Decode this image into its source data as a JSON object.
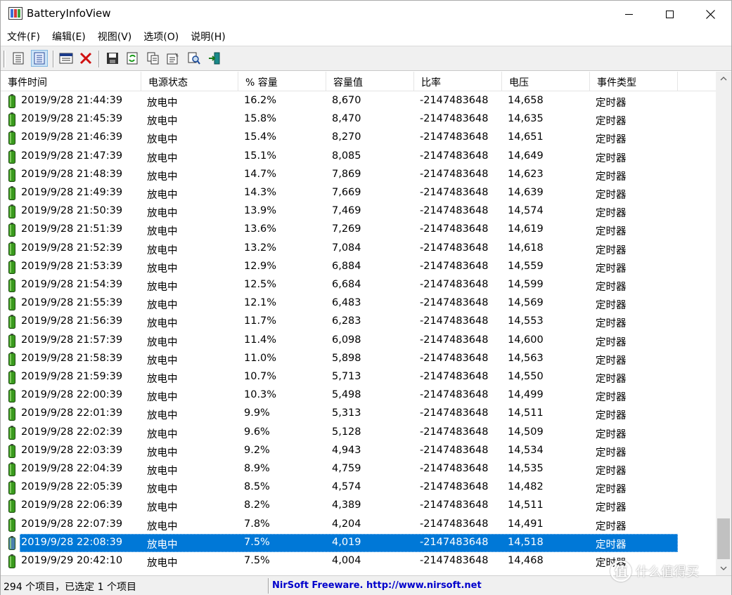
{
  "window": {
    "title": "BatteryInfoView"
  },
  "menu": [
    "文件(F)",
    "编辑(E)",
    "视图(V)",
    "选项(O)",
    "说明(H)"
  ],
  "toolbar": {
    "buttons": [
      "general-view-icon",
      "log-view-icon",
      "properties-window-icon",
      "delete-icon",
      "save-icon",
      "refresh-icon",
      "copy-icon",
      "properties-icon",
      "find-icon",
      "exit-icon"
    ]
  },
  "columns": [
    "事件时间",
    "电源状态",
    "% 容量",
    "容量值",
    "比率",
    "电压",
    "事件类型"
  ],
  "rows": [
    [
      "2019/9/28 21:44:39",
      "放电中",
      "16.2%",
      "8,670",
      "-2147483648",
      "14,658",
      "定时器"
    ],
    [
      "2019/9/28 21:45:39",
      "放电中",
      "15.8%",
      "8,470",
      "-2147483648",
      "14,635",
      "定时器"
    ],
    [
      "2019/9/28 21:46:39",
      "放电中",
      "15.4%",
      "8,270",
      "-2147483648",
      "14,651",
      "定时器"
    ],
    [
      "2019/9/28 21:47:39",
      "放电中",
      "15.1%",
      "8,085",
      "-2147483648",
      "14,649",
      "定时器"
    ],
    [
      "2019/9/28 21:48:39",
      "放电中",
      "14.7%",
      "7,869",
      "-2147483648",
      "14,623",
      "定时器"
    ],
    [
      "2019/9/28 21:49:39",
      "放电中",
      "14.3%",
      "7,669",
      "-2147483648",
      "14,639",
      "定时器"
    ],
    [
      "2019/9/28 21:50:39",
      "放电中",
      "13.9%",
      "7,469",
      "-2147483648",
      "14,574",
      "定时器"
    ],
    [
      "2019/9/28 21:51:39",
      "放电中",
      "13.6%",
      "7,269",
      "-2147483648",
      "14,619",
      "定时器"
    ],
    [
      "2019/9/28 21:52:39",
      "放电中",
      "13.2%",
      "7,084",
      "-2147483648",
      "14,618",
      "定时器"
    ],
    [
      "2019/9/28 21:53:39",
      "放电中",
      "12.9%",
      "6,884",
      "-2147483648",
      "14,559",
      "定时器"
    ],
    [
      "2019/9/28 21:54:39",
      "放电中",
      "12.5%",
      "6,684",
      "-2147483648",
      "14,599",
      "定时器"
    ],
    [
      "2019/9/28 21:55:39",
      "放电中",
      "12.1%",
      "6,483",
      "-2147483648",
      "14,569",
      "定时器"
    ],
    [
      "2019/9/28 21:56:39",
      "放电中",
      "11.7%",
      "6,283",
      "-2147483648",
      "14,553",
      "定时器"
    ],
    [
      "2019/9/28 21:57:39",
      "放电中",
      "11.4%",
      "6,098",
      "-2147483648",
      "14,600",
      "定时器"
    ],
    [
      "2019/9/28 21:58:39",
      "放电中",
      "11.0%",
      "5,898",
      "-2147483648",
      "14,563",
      "定时器"
    ],
    [
      "2019/9/28 21:59:39",
      "放电中",
      "10.7%",
      "5,713",
      "-2147483648",
      "14,550",
      "定时器"
    ],
    [
      "2019/9/28 22:00:39",
      "放电中",
      "10.3%",
      "5,498",
      "-2147483648",
      "14,499",
      "定时器"
    ],
    [
      "2019/9/28 22:01:39",
      "放电中",
      "9.9%",
      "5,313",
      "-2147483648",
      "14,511",
      "定时器"
    ],
    [
      "2019/9/28 22:02:39",
      "放电中",
      "9.6%",
      "5,128",
      "-2147483648",
      "14,509",
      "定时器"
    ],
    [
      "2019/9/28 22:03:39",
      "放电中",
      "9.2%",
      "4,943",
      "-2147483648",
      "14,534",
      "定时器"
    ],
    [
      "2019/9/28 22:04:39",
      "放电中",
      "8.9%",
      "4,759",
      "-2147483648",
      "14,535",
      "定时器"
    ],
    [
      "2019/9/28 22:05:39",
      "放电中",
      "8.5%",
      "4,574",
      "-2147483648",
      "14,482",
      "定时器"
    ],
    [
      "2019/9/28 22:06:39",
      "放电中",
      "8.2%",
      "4,389",
      "-2147483648",
      "14,511",
      "定时器"
    ],
    [
      "2019/9/28 22:07:39",
      "放电中",
      "7.8%",
      "4,204",
      "-2147483648",
      "14,491",
      "定时器"
    ],
    [
      "2019/9/28 22:08:39",
      "放电中",
      "7.5%",
      "4,019",
      "-2147483648",
      "14,518",
      "定时器"
    ],
    [
      "2019/9/29 20:42:10",
      "放电中",
      "7.5%",
      "4,004",
      "-2147483648",
      "14,468",
      "定时器"
    ]
  ],
  "selected_row": 24,
  "status": {
    "items": "294 个项目，已选定 1 个项目",
    "link": "NirSoft Freeware.  http://www.nirsoft.net"
  },
  "watermark": {
    "mark": "值",
    "text": "什么值得买"
  },
  "colors": {
    "selection": "#0078d7",
    "link": "#0000cc",
    "battery": "#3a9a1e"
  }
}
